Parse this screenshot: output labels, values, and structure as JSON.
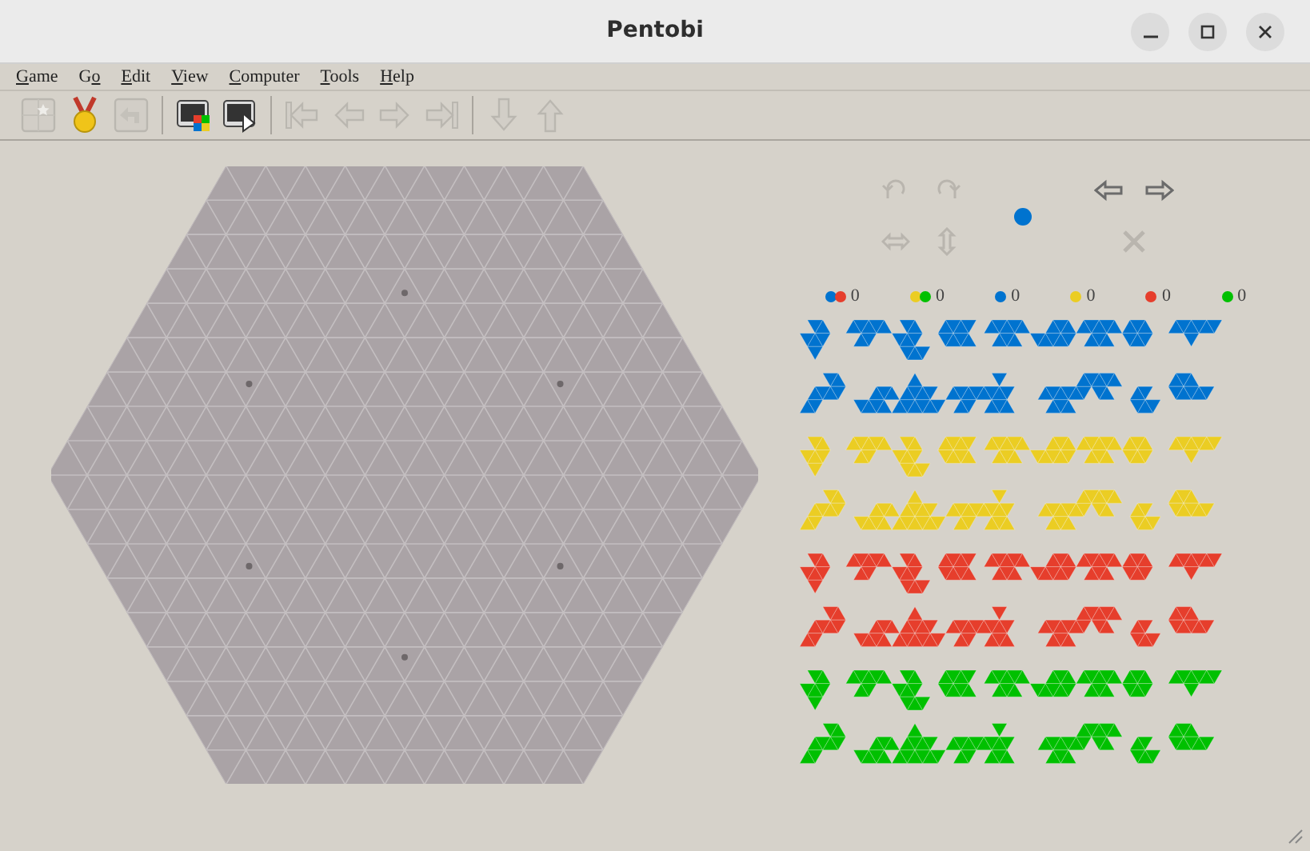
{
  "window": {
    "title": "Pentobi"
  },
  "menu": [
    {
      "accel": "G",
      "rest": "ame"
    },
    {
      "lead": "G",
      "accel": "o"
    },
    {
      "accel": "E",
      "rest": "dit"
    },
    {
      "accel": "V",
      "rest": "iew"
    },
    {
      "accel": "C",
      "rest": "omputer"
    },
    {
      "accel": "T",
      "rest": "ools"
    },
    {
      "accel": "H",
      "rest": "elp"
    }
  ],
  "toolbar": [
    {
      "kind": "new",
      "disabled": true
    },
    {
      "kind": "rating",
      "disabled": false
    },
    {
      "kind": "undo",
      "disabled": true
    },
    {
      "kind": "sep"
    },
    {
      "kind": "computer-colors",
      "disabled": false
    },
    {
      "kind": "play",
      "disabled": false
    },
    {
      "kind": "sep"
    },
    {
      "kind": "first",
      "disabled": true
    },
    {
      "kind": "back",
      "disabled": true
    },
    {
      "kind": "forward",
      "disabled": true
    },
    {
      "kind": "last",
      "disabled": true
    },
    {
      "kind": "sep"
    },
    {
      "kind": "down",
      "disabled": true
    },
    {
      "kind": "up",
      "disabled": true
    }
  ],
  "piece_controls": [
    {
      "kind": "rotate-left",
      "disabled": true
    },
    {
      "kind": "rotate-right",
      "disabled": true
    },
    {
      "kind": "flip-horizontal",
      "disabled": true
    },
    {
      "kind": "flip-vertical",
      "disabled": true
    },
    {
      "kind": "previous",
      "disabled": false
    },
    {
      "kind": "next",
      "disabled": false
    },
    {
      "kind": "clear",
      "disabled": true
    }
  ],
  "current_player": {
    "color": "#0073cf"
  },
  "scores": [
    {
      "colors": [
        {
          "color": "#0073cf"
        },
        {
          "color": "#e63e2c"
        }
      ],
      "value": "0"
    },
    {
      "colors": [
        {
          "color": "#ebcd23"
        },
        {
          "color": "#00c000"
        }
      ],
      "value": "0"
    },
    {
      "colors": [
        {
          "color": "#0073cf"
        }
      ],
      "value": "0"
    },
    {
      "colors": [
        {
          "color": "#ebcd23"
        }
      ],
      "value": "0"
    },
    {
      "colors": [
        {
          "color": "#e63e2c"
        }
      ],
      "value": "0"
    },
    {
      "colors": [
        {
          "color": "#00c000"
        }
      ],
      "value": "0"
    }
  ],
  "piece_sets": [
    {
      "color": "#0073cf"
    },
    {
      "color": "#ebcd23"
    },
    {
      "color": "#e63e2c"
    },
    {
      "color": "#00c000"
    }
  ]
}
